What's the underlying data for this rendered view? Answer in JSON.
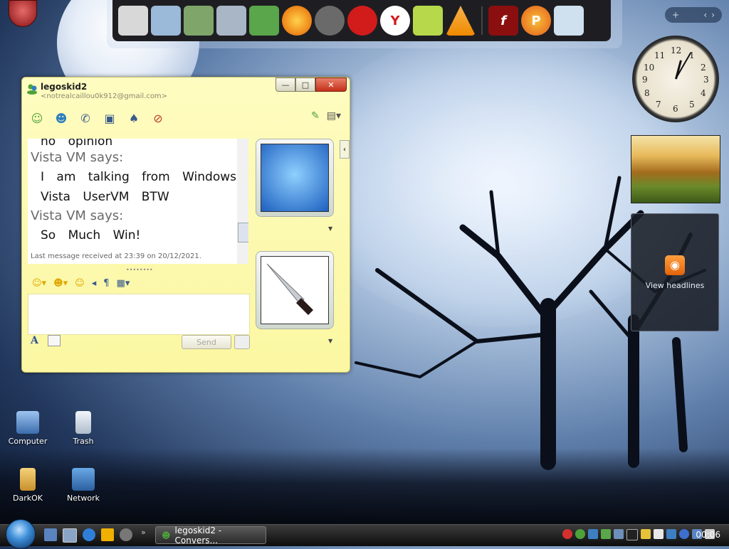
{
  "dock": {
    "apps": [
      {
        "name": "Documents",
        "icon": "document-icon",
        "color": "#d8d8d8"
      },
      {
        "name": "Folder",
        "icon": "folder-icon",
        "color": "#9bb9d8"
      },
      {
        "name": "Pictures",
        "icon": "folder-pictures-icon",
        "color": "#7fa56b"
      },
      {
        "name": "Folder 2",
        "icon": "folder-icon",
        "color": "#a9b6c6"
      },
      {
        "name": "Messenger",
        "icon": "messenger-icon",
        "color": "#5aa64a"
      },
      {
        "name": "Firefox",
        "icon": "firefox-icon",
        "color": "#e66000"
      },
      {
        "name": "Raccoon",
        "icon": "raccoon-icon",
        "color": "#6a6a6a"
      },
      {
        "name": "Opera",
        "icon": "opera-icon",
        "color": "#d21b1b"
      },
      {
        "name": "Yandex",
        "icon": "yandex-icon",
        "color": "#ffffff"
      },
      {
        "name": "Notepad",
        "icon": "notepad-icon",
        "color": "#b6d84a"
      },
      {
        "name": "VLC",
        "icon": "vlc-icon",
        "color": "#f08a00"
      },
      {
        "name": "Flash",
        "icon": "flash-icon",
        "color": "#8b0f0f"
      },
      {
        "name": "Pidgin",
        "icon": "pidgin-icon",
        "color": "#e65a1a"
      },
      {
        "name": "Recycle Bin",
        "icon": "recycle-bin-icon",
        "color": "#cfe0ee"
      }
    ]
  },
  "sidebar": {
    "add": "+",
    "prev": "‹",
    "next": "›",
    "feed_label": "View headlines"
  },
  "clock": {
    "numbers": [
      "12",
      "1",
      "2",
      "3",
      "4",
      "5",
      "6",
      "7",
      "8",
      "9",
      "10",
      "11"
    ]
  },
  "messenger": {
    "contact_name": "legoskid2",
    "contact_email": "<notrealcaillou0k912@gmail.com>",
    "window_buttons": {
      "min": "—",
      "max": "□",
      "close": "✕"
    },
    "chat": [
      {
        "type": "msg",
        "text": "no opinion"
      },
      {
        "type": "says",
        "text": "Vista VM says:"
      },
      {
        "type": "msg",
        "text": "I am talking from Windows"
      },
      {
        "type": "msg",
        "text": "Vista UserVM BTW"
      },
      {
        "type": "says",
        "text": "Vista VM says:"
      },
      {
        "type": "msg",
        "text": "So Much Win!"
      }
    ],
    "last_received": "Last message received at 23:39 on 20/12/2021.",
    "splitter": "••••••••",
    "send_label": "Send",
    "font_label": "A"
  },
  "desktop_icons": [
    {
      "label": "Computer",
      "color": "#5b8ccc"
    },
    {
      "label": "Trash",
      "color": "#cfd9e4"
    },
    {
      "label": "DarkOK",
      "color": "#d6a74a"
    },
    {
      "label": "Network",
      "color": "#3d7fc0"
    }
  ],
  "taskbar": {
    "more": "»",
    "task_label": "legoskid2 - Convers...",
    "time": "00:06"
  }
}
